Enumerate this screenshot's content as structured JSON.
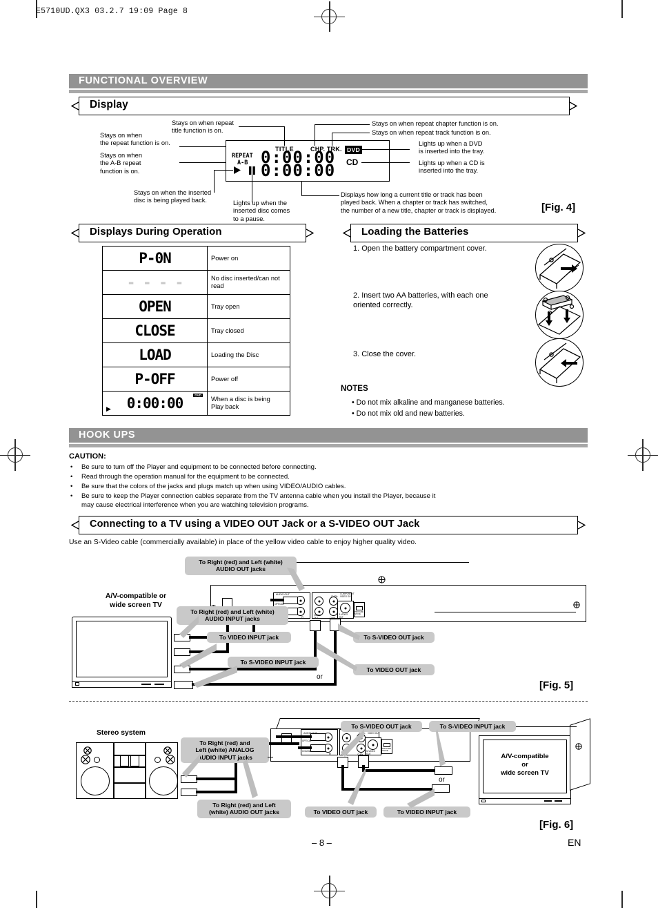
{
  "file_header": "E5710UD.QX3  03.2.7 19:09  Page 8",
  "sections": {
    "functional_overview": "FUNCTIONAL OVERVIEW",
    "hook_ups": "HOOK UPS"
  },
  "display_section": {
    "heading": "Display",
    "fig_label": "[Fig. 4]",
    "callouts": {
      "repeat": "Stays on when\nthe repeat function is on.",
      "ab_repeat": "Stays on when\nthe A-B repeat\nfunction is on.",
      "repeat_title": "Stays on when repeat\ntitle function is on.",
      "repeat_chapter": "Stays on when repeat chapter function is on.",
      "repeat_track": "Stays on when repeat track function is on.",
      "dvd_indicator": "Lights up when a DVD\nis inserted into the tray.",
      "cd_indicator": "Lights up when a CD is\ninserted into the tray.",
      "play": "Stays on when the inserted\ndisc is being played back.",
      "pause": "Lights up when the\ninserted disc comes\nto a pause.",
      "time": "Displays how long a current title or track has been\nplayed back. When a chapter or track has switched,\nthe number of a new title, chapter or track is displayed."
    },
    "lcd": {
      "repeat": "REPEAT",
      "ab": "A-B",
      "title": "TITLE",
      "chp_trk": "CHP. TRK.",
      "dvd": "DVD",
      "cd": "CD",
      "digits": "0:00:00"
    }
  },
  "displays_during_operation": {
    "heading": "Displays During Operation",
    "rows": [
      {
        "display": "P-0N",
        "segments": "P - 0 N",
        "desc": "Power on"
      },
      {
        "display": "- - - -",
        "segments": "-----",
        "desc": "No disc inserted/can not read"
      },
      {
        "display": "OPEN",
        "segments": "O P E N",
        "desc": "Tray open"
      },
      {
        "display": "CLOSE",
        "segments": "C L O S E",
        "desc": "Tray closed"
      },
      {
        "display": "LOAD",
        "segments": "L o A d",
        "desc": "Loading the Disc"
      },
      {
        "display": "P-OFF",
        "segments": "P - O F F",
        "desc": "Power off"
      },
      {
        "display": "0:00:00",
        "segments": "0:00:00",
        "desc": "When a disc is being\nPlay back"
      }
    ]
  },
  "loading_batteries": {
    "heading": "Loading the Batteries",
    "steps": [
      "1. Open the battery compartment cover.",
      "2. Insert two AA batteries, with each one\n    oriented correctly.",
      "3. Close the cover."
    ],
    "notes_title": "NOTES",
    "notes": [
      "• Do not mix alkaline and manganese batteries.",
      "• Do not mix old and new batteries."
    ]
  },
  "hookups": {
    "caution_title": "CAUTION:",
    "caution_items": [
      "Be sure to turn off the Player and equipment to be connected before connecting.",
      "Read through the operation manual for the equipment to be connected.",
      "Be sure that the colors of the jacks and plugs match up when using VIDEO/AUDIO cables.",
      "Be sure to keep the Player connection cables separate from the TV antenna cable when you install the Player, because it\nmay cause electrical interference when you are watching television programs."
    ],
    "subheading": "Connecting to a TV using a VIDEO OUT Jack or a S-VIDEO OUT Jack",
    "intro": "Use an S-Video cable (commercially available) in place of the yellow video cable to enjoy higher quality video."
  },
  "fig5": {
    "label": "[Fig. 5]",
    "tv_label": "A/V-compatible or\nwide screen TV",
    "or_label": "or",
    "callouts": {
      "audio_out": "To Right (red) and Left (white)\nAUDIO OUT jacks",
      "audio_input": "To Right (red) and Left (white)\nAUDIO INPUT jacks",
      "video_input": "To VIDEO INPUT jack",
      "svideo_input": "To S-VIDEO INPUT jack",
      "svideo_out": "To S-VIDEO OUT jack",
      "video_out": "To VIDEO OUT jack"
    },
    "rear_panel": {
      "audio_out": "AUDIO OUT",
      "digital": "DIGITAL",
      "optical": "OPTICAL",
      "coaxial": "COAXIAL",
      "l": "L",
      "r": "R",
      "y": "Y",
      "cb_pb": "Cb/Pb",
      "cr_pr": "Cr/Pr",
      "component": "COMPONENT\nVIDEO OUT",
      "video_out": "VIDEO\nOUT",
      "svideo_out": "S-VIDEO\nOUT",
      "progressive": "PROGRE\nSSIVE"
    }
  },
  "fig6": {
    "label": "[Fig. 6]",
    "stereo_label": "Stereo system",
    "tv_label": "A/V-compatible\nor\nwide screen TV",
    "or_label": "or",
    "callouts": {
      "analog_audio_input": "To Right (red) and\nLeft (white) ANALOG\nAUDIO INPUT jacks",
      "audio_out": "To Right (red) and Left\n(white) AUDIO OUT jacks",
      "svideo_out": "To S-VIDEO OUT jack",
      "svideo_input": "To S-VIDEO INPUT jack",
      "video_out": "To VIDEO OUT jack",
      "video_input": "To VIDEO INPUT jack"
    }
  },
  "footer": {
    "page_number": "– 8 –",
    "language": "EN"
  }
}
